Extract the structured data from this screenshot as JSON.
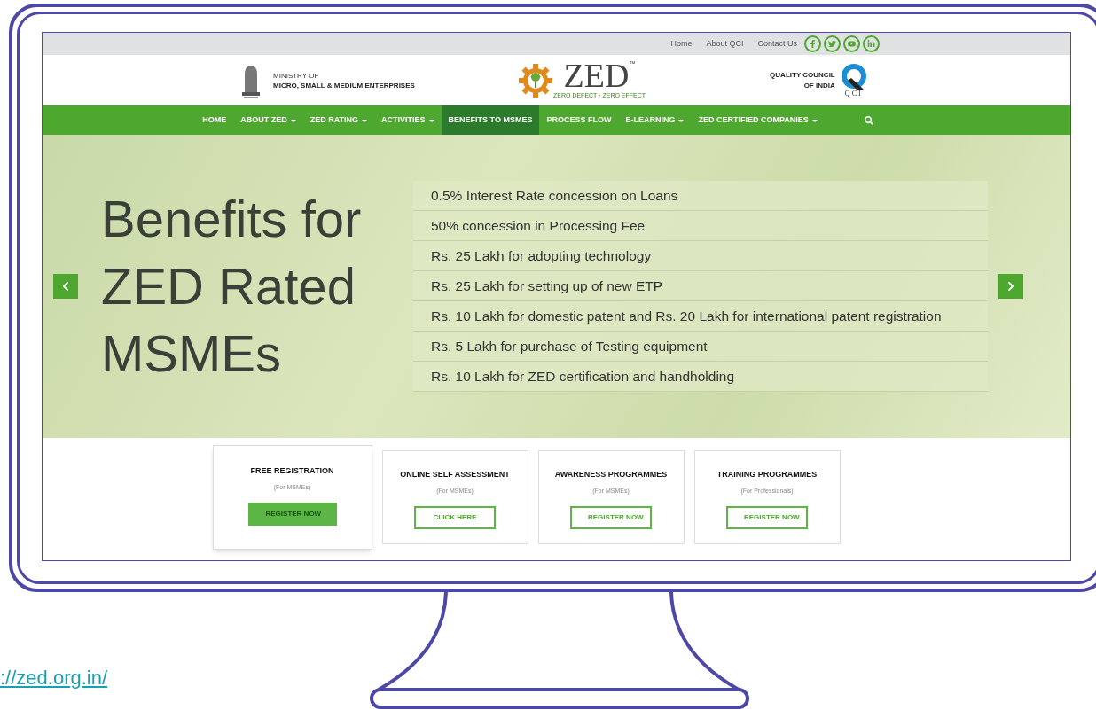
{
  "top_links": [
    "Home",
    "About QCI",
    "Contact Us"
  ],
  "social": [
    {
      "kind": "facebook"
    },
    {
      "kind": "twitter"
    },
    {
      "kind": "youtube"
    },
    {
      "kind": "linkedin"
    }
  ],
  "header": {
    "ministry_line1": "MINISTRY OF",
    "ministry_line2": "MICRO, SMALL & MEDIUM ENTERPRISES",
    "logo_text": "ZED",
    "logo_tm": "™",
    "logo_tagline": "ZERO DEFECT · ZERO EFFECT",
    "qci_line1": "QUALITY COUNCIL",
    "qci_line2": "OF INDIA",
    "qci_mark": "QCI"
  },
  "nav": [
    {
      "label": "HOME",
      "dropdown": false,
      "selected": false
    },
    {
      "label": "ABOUT ZED",
      "dropdown": true,
      "selected": false
    },
    {
      "label": "ZED RATING",
      "dropdown": true,
      "selected": false
    },
    {
      "label": "ACTIVITIES",
      "dropdown": true,
      "selected": false
    },
    {
      "label": "BENEFITS TO MSMES",
      "dropdown": false,
      "selected": true
    },
    {
      "label": "PROCESS FLOW",
      "dropdown": false,
      "selected": false
    },
    {
      "label": "E-LEARNING",
      "dropdown": true,
      "selected": false
    },
    {
      "label": "ZED CERTIFIED COMPANIES",
      "dropdown": true,
      "selected": false
    }
  ],
  "hero": {
    "headline": [
      "Benefits for",
      "ZED Rated",
      "MSMEs"
    ],
    "benefits": [
      "0.5% Interest Rate concession on Loans",
      "50% concession in Processing Fee",
      "Rs. 25 Lakh for adopting technology",
      "Rs. 25 Lakh for setting up of new ETP",
      "Rs. 10 Lakh for domestic patent and Rs. 20 Lakh for international patent registration",
      "Rs. 5 Lakh for purchase of Testing equipment",
      "Rs. 10 Lakh for ZED certification and handholding"
    ]
  },
  "cards": [
    {
      "title": "FREE REGISTRATION",
      "subtitle": "(For MSMEs)",
      "button": "REGISTER NOW",
      "selected": true
    },
    {
      "title": "ONLINE SELF ASSESSMENT",
      "subtitle": "(For MSMEs)",
      "button": "CLICK HERE",
      "selected": false
    },
    {
      "title": "AWARENESS PROGRAMMES",
      "subtitle": "(For MSMEs)",
      "button": "REGISTER NOW",
      "selected": false
    },
    {
      "title": "TRAINING PROGRAMMES",
      "subtitle": "(For Professionals)",
      "button": "REGISTER NOW",
      "selected": false
    }
  ],
  "url": "://zed.org.in/"
}
